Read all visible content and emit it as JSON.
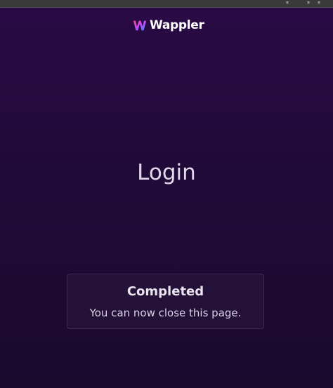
{
  "app": {
    "logo_text": "Wappler"
  },
  "page": {
    "heading": "Login"
  },
  "status_card": {
    "title": "Completed",
    "message": "You can now close this page."
  },
  "colors": {
    "background_top": "#2a0a45",
    "background_bottom": "#1a0a2e",
    "logo_gradient_start": "#ff3d7f",
    "logo_gradient_end": "#3a8dff"
  }
}
